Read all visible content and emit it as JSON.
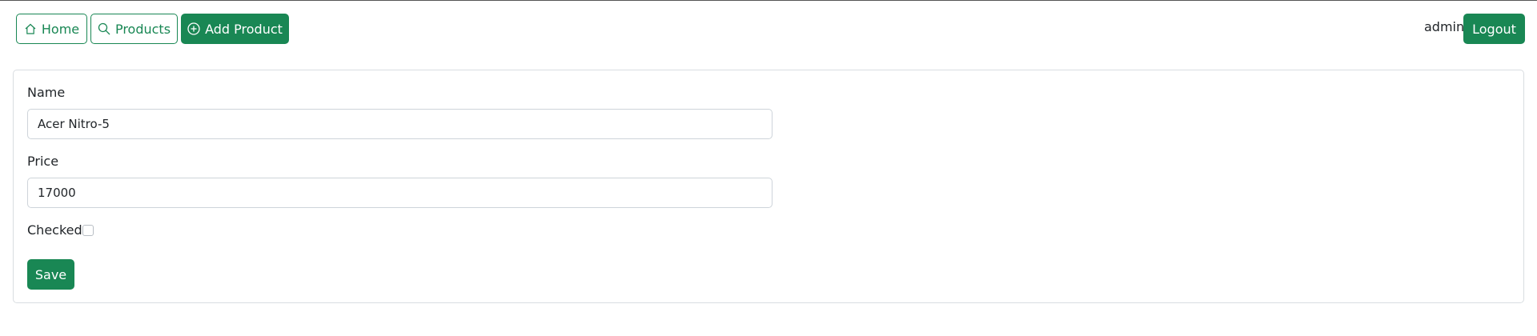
{
  "navbar": {
    "home_label": "Home",
    "products_label": "Products",
    "add_product_label": "Add Product",
    "username": "admin",
    "logout_label": "Logout"
  },
  "form": {
    "name_label": "Name",
    "name_value": "Acer Nitro-5",
    "price_label": "Price",
    "price_value": "17000",
    "checked_label": "Checked",
    "checked": false,
    "save_label": "Save"
  },
  "icons": {
    "home": "home-icon",
    "search": "search-icon",
    "add": "plus-circle-icon"
  },
  "colors": {
    "accent": "#198754",
    "border": "#ced4da"
  }
}
